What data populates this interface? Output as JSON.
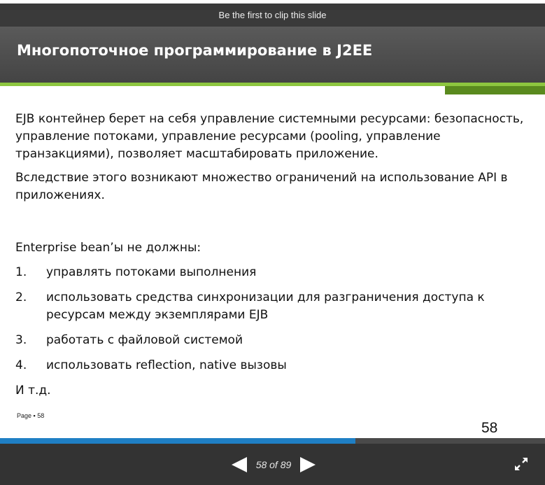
{
  "clip_bar": {
    "text": "Be the first to clip this slide"
  },
  "slide": {
    "title": "Многопоточное программирование в J2EE",
    "paragraphs": [
      "EJB контейнер берет на себя управление системными ресурсами: безопасность, управление потоками, управление ресурсами (pooling, управление транзакциями), позволяет масштабировать приложение.",
      "Вследствие этого возникают множество ограничений на использование API в приложениях."
    ],
    "list_intro": "Enterprise bean’ы не должны:",
    "list_items": [
      {
        "num": "1.",
        "text": "управлять потоками выполнения"
      },
      {
        "num": "2.",
        "text": "использовать средства синхронизации для разграничения доступа к ресурсам между экземплярами EJB"
      },
      {
        "num": "3.",
        "text": "работать с файловой системой"
      },
      {
        "num": "4.",
        "text": "использовать reflection, native вызовы"
      }
    ],
    "outro": "И т.д.",
    "footer": "Page ▪ 58",
    "number": "58"
  },
  "player": {
    "page_counter": "58 of 89",
    "progress": 0.652,
    "icons": {
      "prev": "prev-arrow-icon",
      "next": "next-arrow-icon",
      "fullscreen": "fullscreen-expand-icon"
    }
  },
  "colors": {
    "accent_green": "#8dc63f",
    "dark_green": "#5a8a1e",
    "progress_blue": "#1f7fc4",
    "header_gray": "#4f4f4f"
  }
}
